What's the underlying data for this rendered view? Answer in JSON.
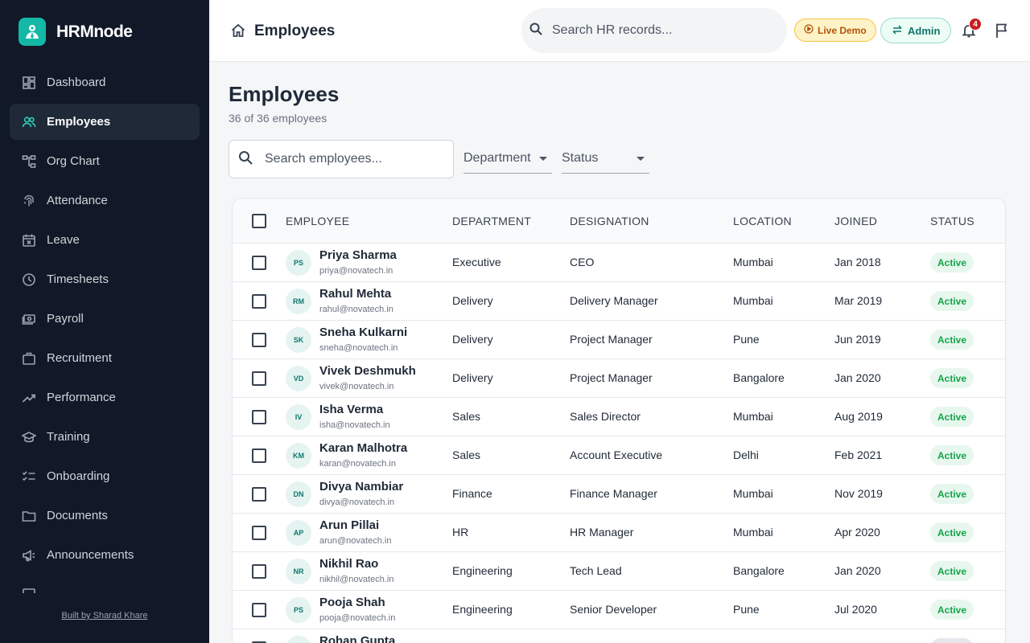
{
  "app": {
    "name": "HRMnode",
    "credit": "Built by Sharad Khare"
  },
  "sidebar": {
    "items": [
      {
        "label": "Dashboard",
        "icon": "dashboard-icon",
        "active": false
      },
      {
        "label": "Employees",
        "icon": "people-icon",
        "active": true
      },
      {
        "label": "Org Chart",
        "icon": "org-chart-icon",
        "active": false
      },
      {
        "label": "Attendance",
        "icon": "fingerprint-icon",
        "active": false
      },
      {
        "label": "Leave",
        "icon": "calendar-x-icon",
        "active": false
      },
      {
        "label": "Timesheets",
        "icon": "clock-icon",
        "active": false
      },
      {
        "label": "Payroll",
        "icon": "money-icon",
        "active": false
      },
      {
        "label": "Recruitment",
        "icon": "briefcase-icon",
        "active": false
      },
      {
        "label": "Performance",
        "icon": "trending-up-icon",
        "active": false
      },
      {
        "label": "Training",
        "icon": "school-icon",
        "active": false
      },
      {
        "label": "Onboarding",
        "icon": "checklist-icon",
        "active": false
      },
      {
        "label": "Documents",
        "icon": "folder-icon",
        "active": false
      },
      {
        "label": "Announcements",
        "icon": "megaphone-icon",
        "active": false
      },
      {
        "label": "",
        "icon": "expenses-icon",
        "active": false
      }
    ]
  },
  "header": {
    "title": "Employees",
    "search_placeholder": "Search HR records...",
    "live_demo_label": "Live Demo",
    "admin_label": "Admin",
    "notification_count": "4"
  },
  "main": {
    "title": "Employees",
    "subtitle": "36 of 36 employees",
    "search_placeholder": "Search employees...",
    "department_filter": "Department",
    "status_filter": "Status"
  },
  "table": {
    "columns": [
      "EMPLOYEE",
      "DEPARTMENT",
      "DESIGNATION",
      "LOCATION",
      "JOINED",
      "STATUS"
    ],
    "rows": [
      {
        "initials": "PS",
        "name": "Priya Sharma",
        "email": "priya@novatech.in",
        "department": "Executive",
        "designation": "CEO",
        "location": "Mumbai",
        "joined": "Jan 2018",
        "status": "Active"
      },
      {
        "initials": "RM",
        "name": "Rahul Mehta",
        "email": "rahul@novatech.in",
        "department": "Delivery",
        "designation": "Delivery Manager",
        "location": "Mumbai",
        "joined": "Mar 2019",
        "status": "Active"
      },
      {
        "initials": "SK",
        "name": "Sneha Kulkarni",
        "email": "sneha@novatech.in",
        "department": "Delivery",
        "designation": "Project Manager",
        "location": "Pune",
        "joined": "Jun 2019",
        "status": "Active"
      },
      {
        "initials": "VD",
        "name": "Vivek Deshmukh",
        "email": "vivek@novatech.in",
        "department": "Delivery",
        "designation": "Project Manager",
        "location": "Bangalore",
        "joined": "Jan 2020",
        "status": "Active"
      },
      {
        "initials": "IV",
        "name": "Isha Verma",
        "email": "isha@novatech.in",
        "department": "Sales",
        "designation": "Sales Director",
        "location": "Mumbai",
        "joined": "Aug 2019",
        "status": "Active"
      },
      {
        "initials": "KM",
        "name": "Karan Malhotra",
        "email": "karan@novatech.in",
        "department": "Sales",
        "designation": "Account Executive",
        "location": "Delhi",
        "joined": "Feb 2021",
        "status": "Active"
      },
      {
        "initials": "DN",
        "name": "Divya Nambiar",
        "email": "divya@novatech.in",
        "department": "Finance",
        "designation": "Finance Manager",
        "location": "Mumbai",
        "joined": "Nov 2019",
        "status": "Active"
      },
      {
        "initials": "AP",
        "name": "Arun Pillai",
        "email": "arun@novatech.in",
        "department": "HR",
        "designation": "HR Manager",
        "location": "Mumbai",
        "joined": "Apr 2020",
        "status": "Active"
      },
      {
        "initials": "NR",
        "name": "Nikhil Rao",
        "email": "nikhil@novatech.in",
        "department": "Engineering",
        "designation": "Tech Lead",
        "location": "Bangalore",
        "joined": "Jan 2020",
        "status": "Active"
      },
      {
        "initials": "PS",
        "name": "Pooja Shah",
        "email": "pooja@novatech.in",
        "department": "Engineering",
        "designation": "Senior Developer",
        "location": "Pune",
        "joined": "Jul 2020",
        "status": "Active"
      },
      {
        "initials": "RG",
        "name": "Rohan Gupta",
        "email": "",
        "department": "",
        "designation": "",
        "location": "",
        "joined": "",
        "status": ""
      }
    ]
  },
  "colors": {
    "sidebar_bg": "#111827",
    "accent": "#14b8a6",
    "active_badge": "#16a34a",
    "notification": "#c81e1e"
  }
}
